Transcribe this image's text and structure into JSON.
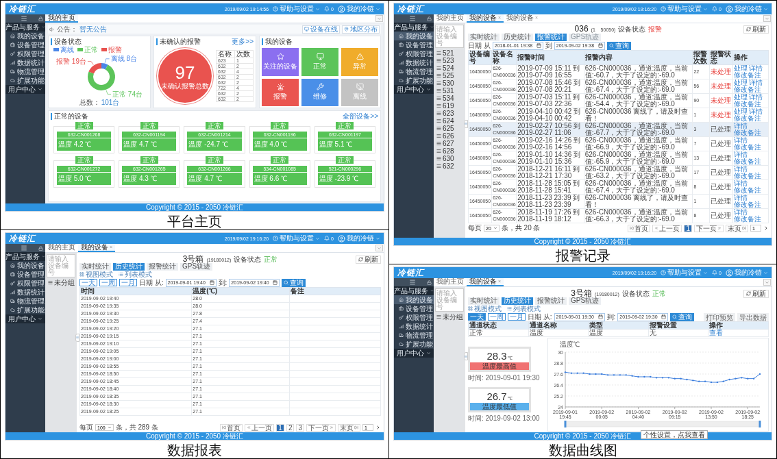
{
  "panels": [
    {
      "kind": "dashboard",
      "caption": "平台主页",
      "header": {
        "logo": "冷链汇",
        "datetime": "2019/09/02 19:14:56",
        "help": "帮助与设置",
        "notifications": "0",
        "user": "我的冷链"
      },
      "sidebar": [
        {
          "kind": "group",
          "label": "产品与服务",
          "selected": false
        },
        {
          "kind": "item",
          "label": "我的设备",
          "selected": false
        },
        {
          "kind": "item",
          "label": "设备管理",
          "selected": false
        },
        {
          "kind": "item",
          "label": "权限管理",
          "selected": false
        },
        {
          "kind": "item",
          "label": "数据统计",
          "selected": false
        },
        {
          "kind": "item",
          "label": "物流管理",
          "selected": false
        },
        {
          "kind": "item",
          "label": "扩展功能",
          "selected": false
        },
        {
          "kind": "group",
          "label": "用户中心",
          "selected": false
        }
      ],
      "tabs": [
        {
          "label": "我的主页",
          "selected": true
        }
      ],
      "notice": {
        "label": "公告：",
        "text": "暂无公告",
        "buttons": [
          "设备在线",
          "地区分布"
        ]
      },
      "status_card": {
        "title": "设备状态",
        "legend": [
          {
            "color": "#4a86e8"
          },
          {
            "color": "#5cc45a"
          },
          {
            "color": "#e8514e"
          }
        ],
        "chart_data": {
          "type": "donut",
          "categories": [
            "离线",
            "正常",
            "报警"
          ],
          "values": [
            8,
            74,
            19
          ],
          "value_labels": [
            "离线 8台",
            "正常 74台",
            "报警 19台"
          ]
        },
        "total_label": "总数：",
        "total": "101台"
      },
      "alarm_card": {
        "title": "未确认的报警",
        "more": "更多>>",
        "count": "97",
        "count_label": "未确认报警总数",
        "columns": [
          "名称",
          "次数"
        ],
        "rows": [
          [
            "623",
            "1"
          ],
          [
            "632",
            "2"
          ],
          [
            "632",
            "4"
          ],
          [
            "632",
            "2"
          ],
          [
            "632",
            "2"
          ],
          [
            "722",
            "4"
          ],
          [
            "632",
            "2"
          ],
          [
            "632",
            "2"
          ]
        ]
      },
      "devices_card": {
        "title": "我的设备",
        "tiles": [
          {
            "label": "关注的设备",
            "color": "#8b6ff0"
          },
          {
            "label": "正常",
            "color": "#5cc45a"
          },
          {
            "label": "异常",
            "color": "#f0ac2b"
          },
          {
            "label": "报警",
            "color": "#ea5550"
          },
          {
            "label": "维修",
            "color": "#4a8fe8"
          },
          {
            "label": "离线",
            "color": "#c3c3c3"
          }
        ]
      },
      "normal_card": {
        "title": "正常的设备",
        "more": "全部设备>>",
        "devices": [
          {
            "status": "正常",
            "id": "632-CN001268",
            "temp": "温度 4.2 ℃"
          },
          {
            "status": "正常",
            "id": "632-CN001194",
            "temp": "温度 4.7 ℃"
          },
          {
            "status": "正常",
            "id": "632-CN001214",
            "temp": "温度 -24.7 ℃"
          },
          {
            "status": "正常",
            "id": "632-CN001196",
            "temp": "温度 4.0 ℃"
          },
          {
            "status": "正常",
            "id": "632-CN001197",
            "temp": "温度 5.1 ℃"
          },
          {
            "status": "正常",
            "id": "632-CN001272",
            "temp": "温度 5.0 ℃"
          },
          {
            "status": "正常",
            "id": "632-CN001265",
            "temp": "温度 4.3 ℃"
          },
          {
            "status": "正常",
            "id": "632-CN001266",
            "temp": "温度 4.7 ℃"
          },
          {
            "status": "正常",
            "id": "534-CN001085",
            "temp": "温度 6.6 ℃"
          },
          {
            "status": "正常",
            "id": "521-CN000296",
            "temp": "温度 -23.9 ℃"
          }
        ]
      },
      "footer": "Copyright © 2015 - 2050 冷链汇"
    },
    {
      "kind": "alarm_log",
      "caption": "报警记录",
      "header": {
        "logo": "冷链汇",
        "datetime": "2019/09/02 19:16:20",
        "help": "帮助与设置",
        "notifications": "0",
        "user": "我的冷链"
      },
      "sidebar": [
        {
          "kind": "group",
          "label": "产品与服务",
          "selected": false
        },
        {
          "kind": "item",
          "label": "我的设备",
          "selected": true
        },
        {
          "kind": "item",
          "label": "设备管理",
          "selected": false
        },
        {
          "kind": "item",
          "label": "权限管理",
          "selected": false
        },
        {
          "kind": "item",
          "label": "数据统计",
          "selected": false
        },
        {
          "kind": "item",
          "label": "物流管理",
          "selected": false
        },
        {
          "kind": "item",
          "label": "扩展功能",
          "selected": false
        },
        {
          "kind": "group",
          "label": "用户中心",
          "selected": false
        }
      ],
      "tabs": [
        {
          "label": "我的主页",
          "selected": false
        },
        {
          "label": "我的设备",
          "selected": true,
          "close": "×"
        },
        {
          "label": "我的设备",
          "selected": false,
          "close": "×"
        }
      ],
      "device": {
        "search_placeholder": "请输入设备编号",
        "tree": [
          "521",
          "523",
          "524",
          "525",
          "530",
          "531",
          "534",
          "619",
          "623",
          "624",
          "625",
          "626",
          "627",
          "628",
          "630",
          "632"
        ],
        "title": "036",
        "code": "(1    50050)",
        "status_label": "设备状态",
        "status": "报警",
        "status_alert": true,
        "refresh": "刷新",
        "subtabs": [
          {
            "label": "实时统计",
            "selected": false,
            "disabled": false
          },
          {
            "label": "历史统计",
            "selected": false,
            "disabled": false
          },
          {
            "label": "报警统计",
            "selected": true,
            "disabled": false
          },
          {
            "label": "GPS轨迹",
            "selected": false,
            "disabled": true
          }
        ],
        "date": {
          "from_label": "日期 从",
          "from": "2018-01-01 19:38",
          "to_label": "到",
          "to": "2019-09-02 19:38",
          "search": "查询"
        }
      },
      "alarm_table": {
        "columns": [
          "设备编号",
          "设备名称",
          "报警时间",
          "报警内容",
          "报警次数",
          "报警状态",
          "操作"
        ],
        "rows": [
          {
            "id": "16450050",
            "name": "626-CN000036",
            "time": "2019-07-09 15:11 到 2019-07-09 16:55",
            "content": "626-CN000036，通道:温度，当前值:-60.7，大于了设定的:-69.0",
            "count": "22",
            "status": "未处理",
            "handled": false,
            "selected": false,
            "actions": [
              "处理",
              "详情",
              "修改备注"
            ]
          },
          {
            "id": "16450050",
            "name": "626-CN000036",
            "time": "2019-07-08 15:46 到 2019-07-08 20:21",
            "content": "626-CN000036，通道:温度，当前值:-67.4，大于了设定的:-69.0",
            "count": "56",
            "status": "未处理",
            "handled": false,
            "selected": false,
            "actions": [
              "处理",
              "详情",
              "修改备注"
            ]
          },
          {
            "id": "16450050",
            "name": "626-CN000036",
            "time": "2019-07-03 15:11 到 2019-07-03 22:36",
            "content": "626-CN000036，通道:温度，当前值:-54.4，大于了设定的:-69.0",
            "count": "90",
            "status": "未处理",
            "handled": false,
            "selected": false,
            "actions": [
              "处理",
              "详情",
              "修改备注"
            ]
          },
          {
            "id": "16450050",
            "name": "626-CN000036",
            "time": "2019-04-10 00:42 到 2019-04-10 00:42",
            "content": "626-CN000036 离线了，请及时查看！",
            "count": "1",
            "status": "未处理",
            "handled": false,
            "selected": false,
            "actions": [
              "处理",
              "详情",
              "修改备注"
            ]
          },
          {
            "id": "16450050",
            "name": "626-CN000036",
            "time": "2019-02-27 10:56 到 2019-02-27 11:06",
            "content": "626-CN000036，通道:温度，当前值:-67.7，大于了设定的:-69.0",
            "count": "3",
            "status": "已处理",
            "handled": true,
            "selected": true,
            "actions": [
              "详情",
              "修改备注"
            ]
          },
          {
            "id": "16450050",
            "name": "626-CN000036",
            "time": "2019-02-16 14:26 到 2019-02-16 14:56",
            "content": "626-CN000036，通道:温度，当前值:-66.9，大于了设定的:-69.0",
            "count": "7",
            "status": "已处理",
            "handled": true,
            "selected": false,
            "actions": [
              "详情",
              "修改备注"
            ]
          },
          {
            "id": "16450050",
            "name": "626-CN000036",
            "time": "2019-01-10 14:36 到 2019-01-10 15:36",
            "content": "626-CN000036，通道:温度，当前值:-65.9，大于了设定的:-69.0",
            "count": "13",
            "status": "已处理",
            "handled": true,
            "selected": false,
            "actions": [
              "详情",
              "修改备注"
            ]
          },
          {
            "id": "16450050",
            "name": "626-CN000036",
            "time": "2018-12-21 16:11 到 2018-12-21 17:30",
            "content": "626-CN000036，通道:温度，当前值:-63.2，大于了设定的:-69.0",
            "count": "17",
            "status": "已处理",
            "handled": true,
            "selected": false,
            "actions": [
              "详情",
              "修改备注"
            ]
          },
          {
            "id": "16450050",
            "name": "626-CN000036",
            "time": "2018-11-28 15:05 到 2018-11-28 15:41",
            "content": "626-CN000036，通道:温度，当前值:-67.4，大于了设定的:-69.0",
            "count": "8",
            "status": "已处理",
            "handled": true,
            "selected": false,
            "actions": [
              "详情",
              "修改备注"
            ]
          },
          {
            "id": "16450050",
            "name": "626-CN000036",
            "time": "2018-11-23 23:39 到 2018-11-23 23:39",
            "content": "626-CN000036 离线了，请及时查看！",
            "count": "1",
            "status": "已处理",
            "handled": true,
            "selected": false,
            "actions": [
              "详情",
              "修改备注"
            ]
          },
          {
            "id": "16450050",
            "name": "626-CN000036",
            "time": "2018-11-19 17:26 到 2018-11-19 18:12",
            "content": "626-CN000036，通道:温度，当前值:-66.3，大于了设定的:-69.0",
            "count": "8",
            "status": "已处理",
            "handled": true,
            "selected": false,
            "actions": [
              "详情",
              "修改备注"
            ]
          }
        ]
      },
      "pagination": {
        "per_page_label": "每页",
        "per_page": "20",
        "total": "条，共 20 条",
        "first": "首页",
        "prev": "上一页",
        "pages": [
          {
            "label": "1",
            "selected": true
          }
        ],
        "next": "下一页",
        "last": "末页",
        "goto": "1"
      },
      "footer": "Copyright © 2015 - 2050 冷链汇"
    },
    {
      "kind": "report",
      "caption": "数据报表",
      "header": {
        "logo": "冷链汇",
        "datetime": "2019/09/02 19:16:20",
        "help": "帮助与设置",
        "notifications": "0",
        "user": "我的冷链"
      },
      "sidebar": [
        {
          "kind": "group",
          "label": "产品与服务",
          "selected": false
        },
        {
          "kind": "item",
          "label": "我的设备",
          "selected": false
        },
        {
          "kind": "item",
          "label": "设备管理",
          "selected": false
        },
        {
          "kind": "item",
          "label": "权限管理",
          "selected": false
        },
        {
          "kind": "item",
          "label": "数据统计",
          "selected": false
        },
        {
          "kind": "item",
          "label": "物流管理",
          "selected": false
        },
        {
          "kind": "item",
          "label": "扩展功能",
          "selected": false
        },
        {
          "kind": "group",
          "label": "用户中心",
          "selected": false
        }
      ],
      "tabs": [
        {
          "label": "我的主页",
          "selected": false
        },
        {
          "label": "我的设备",
          "selected": true,
          "close": "×"
        }
      ],
      "device": {
        "search_placeholder": "请输入设备编号",
        "tree": [
          "未分组"
        ],
        "title": "3号箱",
        "code": "(19180012)",
        "status_label": "设备状态",
        "status": "正常",
        "status_alert": false,
        "refresh": "刷新",
        "subtabs": [
          {
            "label": "实时统计",
            "selected": false,
            "disabled": false
          },
          {
            "label": "历史统计",
            "selected": true,
            "disabled": false
          },
          {
            "label": "报警统计",
            "selected": false,
            "disabled": false
          },
          {
            "label": "GPS轨迹",
            "selected": false,
            "disabled": false
          }
        ],
        "view_modes": [
          "视图模式",
          "列表模式"
        ],
        "quick": [
          {
            "label": "一天",
            "selected": false
          },
          {
            "label": "一周",
            "selected": false
          },
          {
            "label": "一月",
            "selected": false
          }
        ],
        "date": {
          "from_label": "日期 从:",
          "from": "2019-09-01 19:40",
          "to_label": "到:",
          "to": "2019-09-02 19:40",
          "search": "查询"
        }
      },
      "report_table": {
        "columns": [
          "时间",
          "温度(℃)",
          "备注"
        ],
        "rows": [
          {
            "time": "2019-09-02 19:40",
            "temp": "28.0"
          },
          {
            "time": "2019-09-02 19:35",
            "temp": "28.0"
          },
          {
            "time": "2019-09-02 19:30",
            "temp": "27.8"
          },
          {
            "time": "2019-09-02 19:25",
            "temp": "27.4"
          },
          {
            "time": "2019-09-02 19:20",
            "temp": "27.1"
          },
          {
            "time": "2019-09-02 19:15",
            "temp": "27.1"
          },
          {
            "time": "2019-09-02 19:10",
            "temp": "27.1"
          },
          {
            "time": "2019-09-02 19:05",
            "temp": "27.1"
          },
          {
            "time": "2019-09-02 19:00",
            "temp": "27.1"
          },
          {
            "time": "2019-09-02 18:55",
            "temp": "27.1"
          },
          {
            "time": "2019-09-02 18:50",
            "temp": "27.1"
          },
          {
            "time": "2019-09-02 18:45",
            "temp": "27.1"
          },
          {
            "time": "2019-09-02 18:40",
            "temp": "27.1"
          },
          {
            "time": "2019-09-02 18:35",
            "temp": "27.1"
          },
          {
            "time": "2019-09-02 18:30",
            "temp": "27.1"
          },
          {
            "time": "2019-09-02 18:25",
            "temp": "27.1"
          }
        ]
      },
      "pagination": {
        "per_page_label": "每页",
        "per_page": "100",
        "total": "条，共 289 条",
        "first": "首页",
        "prev": "上一页",
        "pages": [
          {
            "label": "1",
            "selected": true
          },
          {
            "label": "2",
            "selected": false
          },
          {
            "label": "3",
            "selected": false
          }
        ],
        "next": "下一页",
        "last": "末页",
        "goto": "1"
      },
      "footer": "Copyright © 2015 - 2050 冷链汇"
    },
    {
      "kind": "curve",
      "caption": "数据曲线图",
      "header": {
        "logo": "冷链汇",
        "datetime": "2019/09/02 19:16:20",
        "help": "帮助与设置",
        "notifications": "0",
        "user": "我的冷链"
      },
      "sidebar": [
        {
          "kind": "group",
          "label": "产品与服务",
          "selected": false
        },
        {
          "kind": "item",
          "label": "我的设备",
          "selected": true
        },
        {
          "kind": "item",
          "label": "设备管理",
          "selected": false
        },
        {
          "kind": "item",
          "label": "权限管理",
          "selected": false
        },
        {
          "kind": "item",
          "label": "数据统计",
          "selected": false
        },
        {
          "kind": "item",
          "label": "物流管理",
          "selected": false
        },
        {
          "kind": "item",
          "label": "扩展功能",
          "selected": false
        },
        {
          "kind": "group",
          "label": "用户中心",
          "selected": false
        }
      ],
      "tabs": [
        {
          "label": "我的主页",
          "selected": false
        },
        {
          "label": "我的设备",
          "selected": true,
          "close": "×"
        }
      ],
      "device": {
        "search_placeholder": "请输入设备编号",
        "tree": [
          "未分组"
        ],
        "title": "3号箱",
        "code": "(19180012)",
        "status_label": "设备状态",
        "status": "正常",
        "status_alert": false,
        "refresh": "刷新",
        "subtabs": [
          {
            "label": "实时统计",
            "selected": false,
            "disabled": false
          },
          {
            "label": "历史统计",
            "selected": true,
            "disabled": false
          },
          {
            "label": "报警统计",
            "selected": false,
            "disabled": false
          },
          {
            "label": "GPS轨迹",
            "selected": false,
            "disabled": false
          }
        ],
        "view_modes": [
          "视图模式",
          "列表模式"
        ],
        "quick": [
          {
            "label": "一天",
            "selected": true
          },
          {
            "label": "一周",
            "selected": false
          },
          {
            "label": "一月",
            "selected": false
          }
        ],
        "date": {
          "from_label": "日期 从:",
          "from": "2019-09-01 19:30",
          "to_label": "到:",
          "to": "2019-09-02 19:30",
          "search": "查询"
        },
        "actions": [
          "打印预览",
          "导出数据"
        ]
      },
      "channel_table": {
        "columns": [
          "通道状态",
          "通道名称",
          "类型",
          "报警设置",
          "操作"
        ],
        "rows": [
          {
            "cells": [
              "正常",
              "温度",
              "温度",
              "无"
            ],
            "action": "查看"
          }
        ]
      },
      "stats": [
        {
          "kind": "max",
          "value": "28.3",
          "unit": "℃",
          "label": "温度最高值",
          "time": "时间: 2019-09-01 19:30"
        },
        {
          "kind": "min",
          "value": "26.7",
          "unit": "℃",
          "label": "温度最低值",
          "time": "时间: 2019-09-02 13:00"
        }
      ],
      "chart_data": {
        "type": "line",
        "ylabel": "温度℃",
        "categories": [
          "2019-09-01 19:45",
          null,
          null,
          null,
          null,
          null,
          "2019-09-02 00:05",
          null,
          null,
          null,
          null,
          null,
          "2019-09-02 04:40",
          null,
          null,
          null,
          null,
          null,
          "2019-09-02 09:15",
          null,
          null,
          null,
          null,
          null,
          "2019-09-02 13:50",
          null,
          null,
          null,
          null,
          null,
          "2019-09-02 18:25",
          null,
          null
        ],
        "series": [
          {
            "color": "#3b7ddd",
            "values": [
              27.8,
              27.7,
              27.7,
              27.7,
              27.6,
              27.6,
              27.6,
              27.5,
              27.5,
              27.5,
              27.5,
              27.4,
              27.3,
              27.3,
              27.3,
              27.2,
              27.2,
              27.2,
              27.1,
              27.1,
              27.0,
              26.9,
              26.8,
              26.8,
              26.7,
              26.7,
              26.8,
              27.0,
              27.1,
              27.2,
              27.1,
              27.1,
              27.6
            ]
          }
        ],
        "ylim": [
          24,
          30
        ],
        "grid": true,
        "yticks": [
          24,
          25.2,
          26.4,
          27.6,
          28.8,
          30
        ]
      },
      "tooltip": "个性设置，点我查看",
      "footer": "Copyright © 2015 - 2050 冷链汇"
    }
  ]
}
